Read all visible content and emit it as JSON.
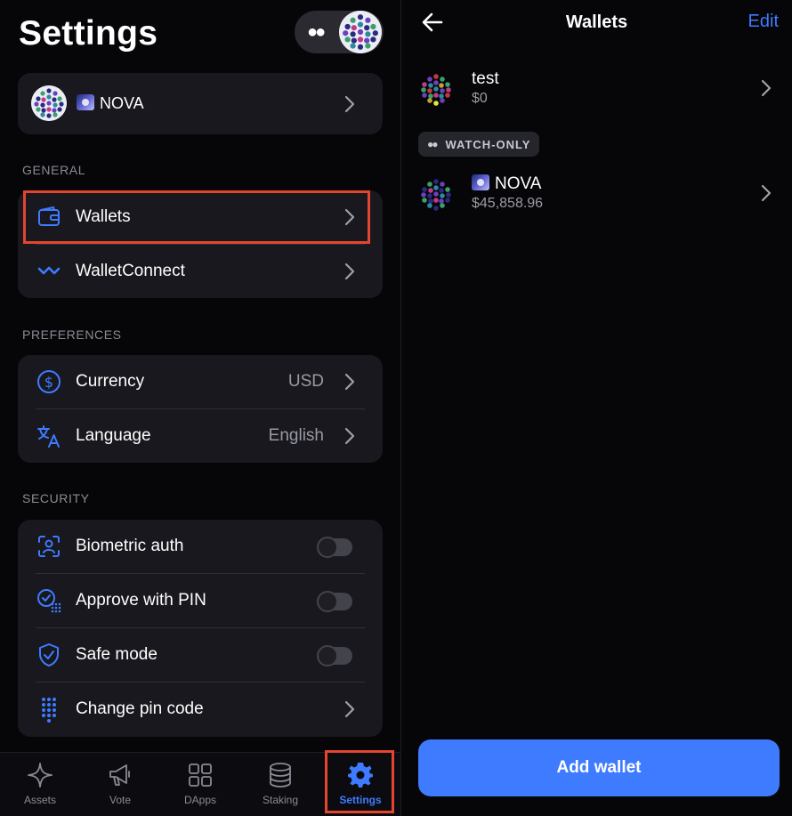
{
  "settings": {
    "title": "Settings",
    "account": {
      "name": "NOVA"
    },
    "sections": {
      "general": "GENERAL",
      "preferences": "PREFERENCES",
      "security": "SECURITY"
    },
    "general_items": [
      {
        "label": "Wallets",
        "icon": "wallet-icon"
      },
      {
        "label": "WalletConnect",
        "icon": "walletconnect-icon"
      }
    ],
    "preference_items": [
      {
        "label": "Currency",
        "value": "USD",
        "icon": "currency-icon"
      },
      {
        "label": "Language",
        "value": "English",
        "icon": "language-icon"
      }
    ],
    "security_items": [
      {
        "label": "Biometric auth",
        "icon": "face-id-icon",
        "toggle": false
      },
      {
        "label": "Approve with PIN",
        "icon": "pin-approve-icon",
        "toggle": false
      },
      {
        "label": "Safe mode",
        "icon": "shield-icon",
        "toggle": false
      },
      {
        "label": "Change pin code",
        "icon": "keypad-icon"
      }
    ]
  },
  "nav": {
    "items": [
      {
        "label": "Assets",
        "icon": "sparkle-icon"
      },
      {
        "label": "Vote",
        "icon": "megaphone-icon"
      },
      {
        "label": "DApps",
        "icon": "grid-icon"
      },
      {
        "label": "Staking",
        "icon": "coins-stack-icon"
      },
      {
        "label": "Settings",
        "icon": "gear-icon",
        "active": true
      }
    ]
  },
  "wallets": {
    "title": "Wallets",
    "edit_label": "Edit",
    "items": [
      {
        "name": "test",
        "balance": "$0"
      },
      {
        "name": "NOVA",
        "balance": "$45,858.96"
      }
    ],
    "watch_only_label": "WATCH-ONLY",
    "add_label": "Add wallet"
  },
  "colors": {
    "accent": "#3e7bff",
    "highlight": "#e4452f",
    "card": "#18181e",
    "background": "#060608"
  }
}
